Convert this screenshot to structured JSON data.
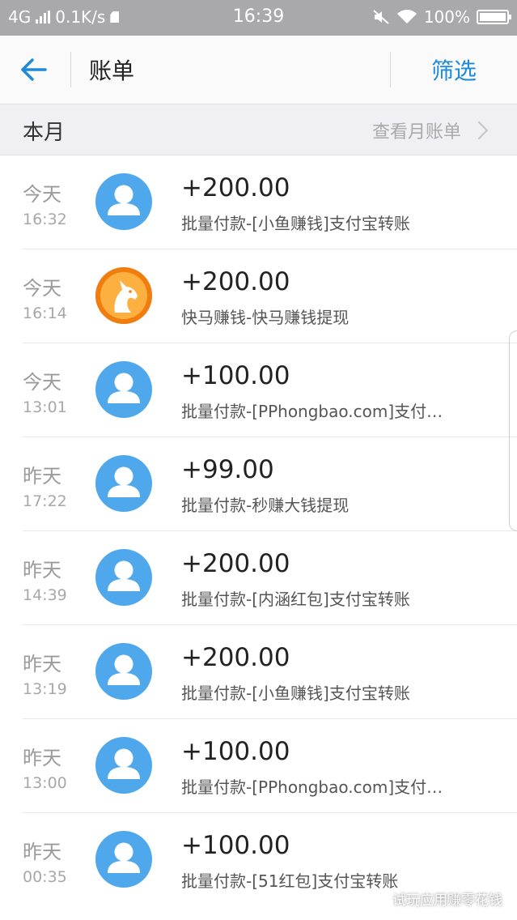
{
  "status_bar": {
    "network": "4G",
    "speed": "0.1K/s",
    "time": "16:39",
    "battery": "100%"
  },
  "nav": {
    "title": "账单",
    "filter_label": "筛选"
  },
  "month": {
    "label": "本月",
    "link_label": "查看月账单"
  },
  "bills": [
    {
      "day": "今天",
      "time": "16:32",
      "amount": "+200.00",
      "desc": "批量付款-[小鱼赚钱]支付宝转账",
      "avatar": "default"
    },
    {
      "day": "今天",
      "time": "16:14",
      "amount": "+200.00",
      "desc": "快马赚钱-快马赚钱提现",
      "avatar": "horse"
    },
    {
      "day": "今天",
      "time": "13:01",
      "amount": "+100.00",
      "desc": "批量付款-[PPhongbao.com]支付…",
      "avatar": "default"
    },
    {
      "day": "昨天",
      "time": "17:22",
      "amount": "+99.00",
      "desc": "批量付款-秒赚大钱提现",
      "avatar": "default"
    },
    {
      "day": "昨天",
      "time": "14:39",
      "amount": "+200.00",
      "desc": "批量付款-[内涵红包]支付宝转账",
      "avatar": "default"
    },
    {
      "day": "昨天",
      "time": "13:19",
      "amount": "+200.00",
      "desc": "批量付款-[小鱼赚钱]支付宝转账",
      "avatar": "default"
    },
    {
      "day": "昨天",
      "time": "13:00",
      "amount": "+100.00",
      "desc": "批量付款-[PPhongbao.com]支付…",
      "avatar": "default"
    },
    {
      "day": "昨天",
      "time": "00:35",
      "amount": "+100.00",
      "desc": "批量付款-[51红包]支付宝转账",
      "avatar": "default"
    }
  ],
  "watermark": "试玩应用赚零花钱",
  "colors": {
    "accent": "#1e8ad8",
    "avatar_blue": "#4fa8ec",
    "avatar_orange": "#f07d0d",
    "status_bar": "#a9a9ab"
  }
}
